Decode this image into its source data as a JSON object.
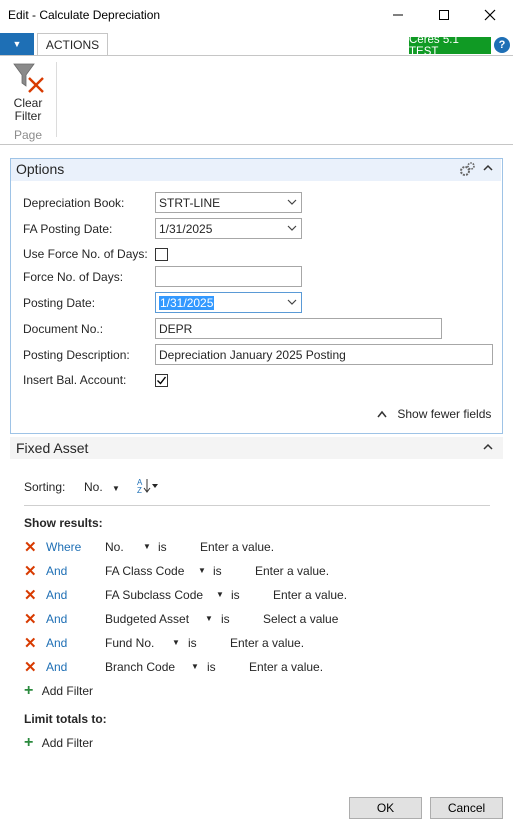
{
  "window": {
    "title": "Edit - Calculate Depreciation"
  },
  "ribbon": {
    "tab_actions": "ACTIONS",
    "badge": "Ceres 5.1 TEST",
    "help": "?",
    "clear_filter": "Clear\nFilter",
    "group_page": "Page"
  },
  "options": {
    "title": "Options",
    "fields": {
      "depreciation_book": {
        "label": "Depreciation Book:",
        "value": "STRT-LINE"
      },
      "fa_posting_date": {
        "label": "FA Posting Date:",
        "value": "1/31/2025"
      },
      "use_force_days": {
        "label": "Use Force No. of Days:",
        "checked": false
      },
      "force_days": {
        "label": "Force No. of Days:",
        "value": ""
      },
      "posting_date": {
        "label": "Posting Date:",
        "value": "1/31/2025"
      },
      "document_no": {
        "label": "Document No.:",
        "value": "DEPR"
      },
      "posting_description": {
        "label": "Posting Description:",
        "value": "Depreciation January 2025 Posting"
      },
      "insert_bal_account": {
        "label": "Insert Bal. Account:",
        "checked": true
      }
    },
    "show_fewer": "Show fewer fields"
  },
  "fixed_asset": {
    "title": "Fixed Asset",
    "sorting_label": "Sorting:",
    "sorting_value": "No.",
    "show_results": "Show results:",
    "filters": [
      {
        "conj": "Where",
        "field": "No.",
        "op": "is",
        "value": "Enter a value."
      },
      {
        "conj": "And",
        "field": "FA Class Code",
        "op": "is",
        "value": "Enter a value."
      },
      {
        "conj": "And",
        "field": "FA Subclass Code",
        "op": "is",
        "value": "Enter a value."
      },
      {
        "conj": "And",
        "field": "Budgeted Asset",
        "op": "is",
        "value": "Select a value"
      },
      {
        "conj": "And",
        "field": "Fund No.",
        "op": "is",
        "value": "Enter a value."
      },
      {
        "conj": "And",
        "field": "Branch Code",
        "op": "is",
        "value": "Enter a value."
      }
    ],
    "add_filter": "Add Filter",
    "limit_totals": "Limit totals to:",
    "add_filter_2": "Add Filter"
  },
  "footer": {
    "ok": "OK",
    "cancel": "Cancel"
  }
}
